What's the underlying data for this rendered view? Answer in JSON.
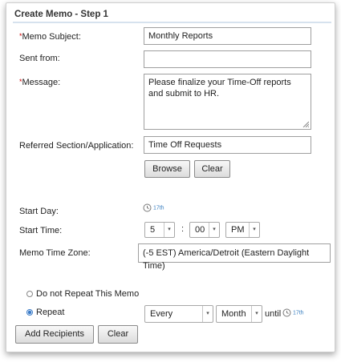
{
  "form": {
    "title": "Create Memo - Step 1",
    "required_mark": "*",
    "memo_subject": {
      "label": "Memo Subject:",
      "value": "Monthly Reports"
    },
    "sent_from": {
      "label": "Sent from:",
      "value": ""
    },
    "message": {
      "label": "Message:",
      "value": "Please finalize your Time-Off reports and submit to HR."
    },
    "referred_section": {
      "label": "Referred Section/Application:",
      "value": "Time Off Requests"
    },
    "browse_label": "Browse",
    "clear_label": "Clear",
    "start_day": {
      "label": "Start Day:",
      "date": "17th"
    },
    "start_time": {
      "label": "Start Time:",
      "hour": "5",
      "separator": ":",
      "minute": "00",
      "ampm": "PM"
    },
    "time_zone": {
      "label": "Memo Time Zone:",
      "value": "(-5 EST) America/Detroit (Eastern Daylight Time)"
    },
    "repeat_options": {
      "no_repeat_label": "Do not Repeat This Memo",
      "repeat_label": "Repeat",
      "selected": "repeat",
      "frequency": "Every",
      "unit": "Month",
      "until_label": "until",
      "until_date": "17th"
    },
    "add_recipients_label": "Add Recipients",
    "bottom_clear_label": "Clear"
  },
  "icons": {
    "calendar": "clock-calendar-icon",
    "dropdown": "chevron-down-icon",
    "resize": "resize-grip-icon"
  },
  "colors": {
    "required": "#cc0000",
    "accent": "#3a7bc8",
    "title_rule": "#d6e2ee"
  }
}
